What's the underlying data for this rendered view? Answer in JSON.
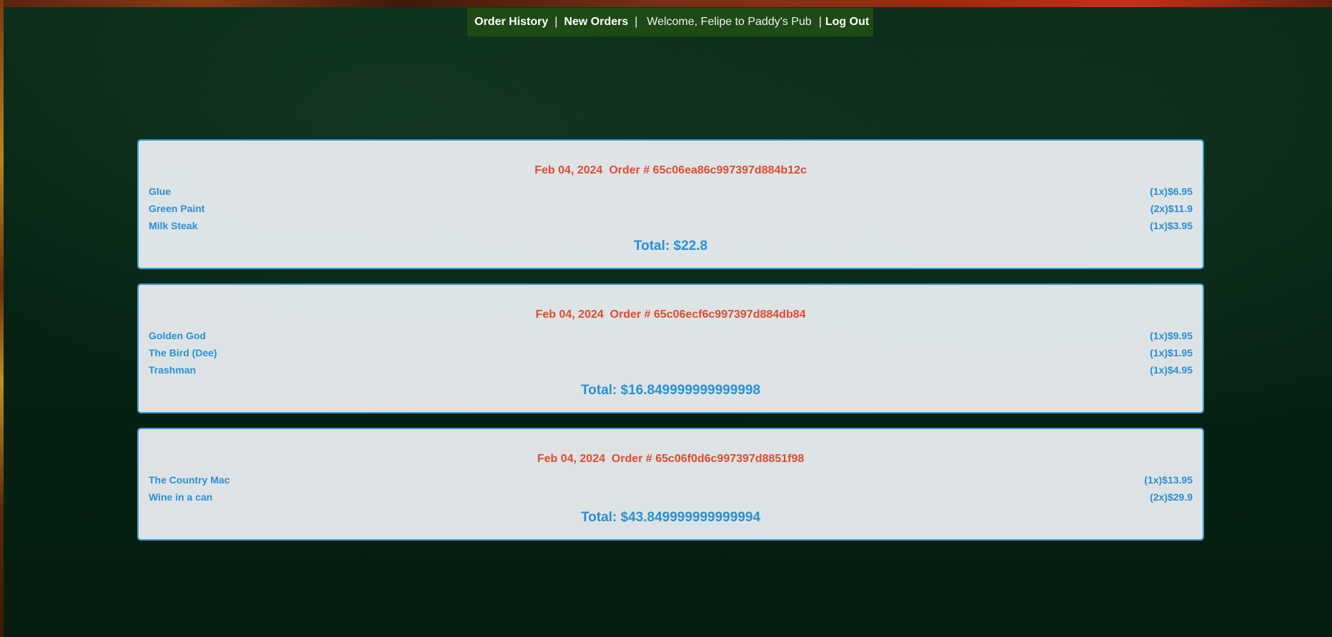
{
  "nav": {
    "order_history": "Order History",
    "sep1": "|",
    "new_orders": "New Orders",
    "sep2": "|",
    "welcome": "Welcome, Felipe to Paddy's Pub",
    "sep3": "|",
    "log_out": "Log Out"
  },
  "orders": [
    {
      "date": "Feb 04, 2024",
      "order_label": "Order # 65c06ea86c997397d884b12c",
      "items": [
        {
          "name": "Glue",
          "qty_price": "(1x)$6.95"
        },
        {
          "name": "Green Paint",
          "qty_price": "(2x)$11.9"
        },
        {
          "name": "Milk Steak",
          "qty_price": "(1x)$3.95"
        }
      ],
      "total": "Total: $22.8"
    },
    {
      "date": "Feb 04, 2024",
      "order_label": "Order # 65c06ecf6c997397d884db84",
      "items": [
        {
          "name": "Golden God",
          "qty_price": "(1x)$9.95"
        },
        {
          "name": "The Bird (Dee)",
          "qty_price": "(1x)$1.95"
        },
        {
          "name": "Trashman",
          "qty_price": "(1x)$4.95"
        }
      ],
      "total": "Total: $16.849999999999998"
    },
    {
      "date": "Feb 04, 2024",
      "order_label": "Order # 65c06f0d6c997397d8851f98",
      "items": [
        {
          "name": "The Country Mac",
          "qty_price": "(1x)$13.95"
        },
        {
          "name": "Wine in a can",
          "qty_price": "(2x)$29.9"
        }
      ],
      "total": "Total: $43.849999999999994"
    }
  ],
  "colors": {
    "header_red": "#e04a30",
    "item_blue": "#2a8fd6",
    "nav_green": "#1e4a16",
    "card_border": "#3a9ad9"
  }
}
